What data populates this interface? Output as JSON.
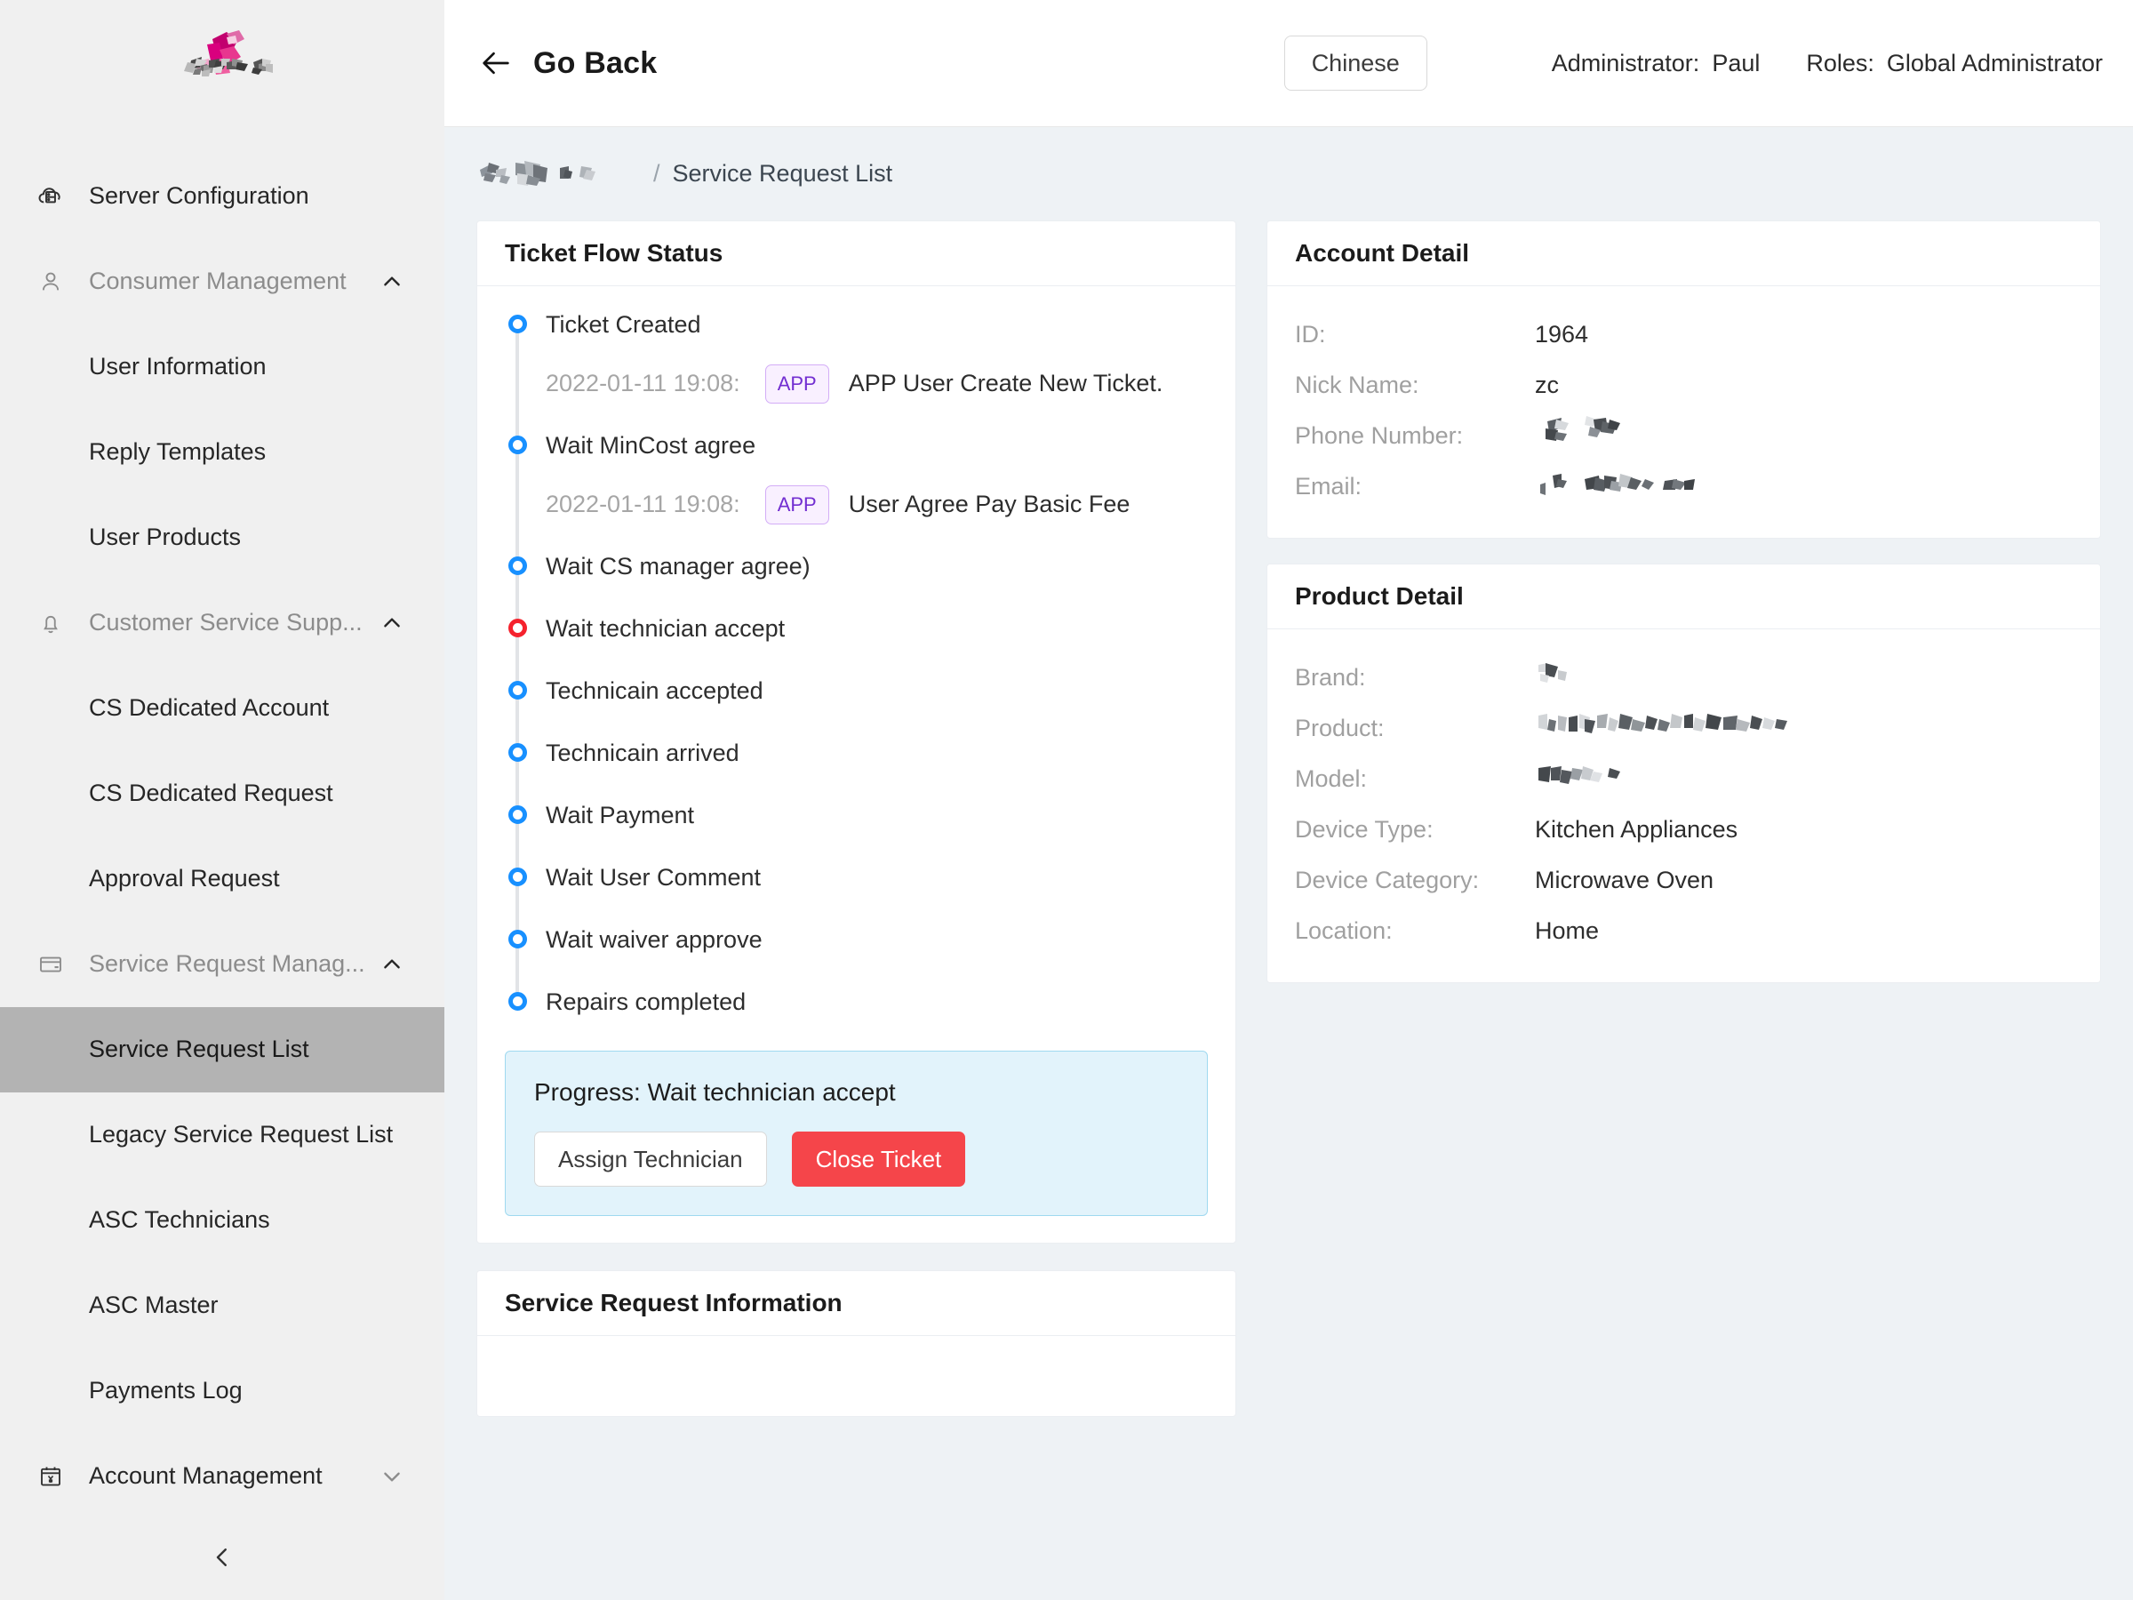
{
  "sidebar": {
    "logo_alt": "company-logo-redacted",
    "items": [
      {
        "type": "group",
        "label": "Server Configuration",
        "icon": "cloud-server-icon",
        "chevron": "",
        "muted": false
      },
      {
        "type": "group",
        "label": "Consumer Management",
        "icon": "user-icon",
        "chevron": "▲",
        "muted": true
      },
      {
        "type": "item",
        "label": "User Information",
        "active": false
      },
      {
        "type": "item",
        "label": "Reply Templates",
        "active": false
      },
      {
        "type": "item",
        "label": "User Products",
        "active": false
      },
      {
        "type": "group",
        "label": "Customer Service Supp...",
        "icon": "bell-icon",
        "chevron": "▲",
        "muted": true
      },
      {
        "type": "item",
        "label": "CS Dedicated Account",
        "active": false
      },
      {
        "type": "item",
        "label": "CS Dedicated Request",
        "active": false
      },
      {
        "type": "item",
        "label": "Approval Request",
        "active": false
      },
      {
        "type": "group",
        "label": "Service Request Manag...",
        "icon": "credit-card-icon",
        "chevron": "▲",
        "muted": true
      },
      {
        "type": "item",
        "label": "Service Request List",
        "active": true
      },
      {
        "type": "item",
        "label": "Legacy Service Request List",
        "active": false
      },
      {
        "type": "item",
        "label": "ASC Technicians",
        "active": false
      },
      {
        "type": "item",
        "label": "ASC Master",
        "active": false
      },
      {
        "type": "item",
        "label": "Payments Log",
        "active": false
      },
      {
        "type": "group",
        "label": "Account Management",
        "icon": "calendar-yen-icon",
        "chevron": "▼",
        "muted": false
      }
    ],
    "collapse_icon": "chevron-left-icon"
  },
  "topbar": {
    "back_icon": "arrow-left-icon",
    "back_label": "Go Back",
    "language_button": "Chinese",
    "administrator_label": "Administrator:",
    "administrator_value": "Paul",
    "roles_label": "Roles:",
    "roles_value": "Global Administrator"
  },
  "breadcrumb": {
    "root": "",
    "separator": "/",
    "current": "Service Request List"
  },
  "ticket_flow": {
    "title": "Ticket Flow Status",
    "steps": [
      {
        "label": "Ticket Created",
        "state": "done",
        "detail": {
          "time": "2022-01-11 19:08:",
          "badge": "APP",
          "message": "APP User Create New Ticket."
        }
      },
      {
        "label": "Wait MinCost agree",
        "state": "done",
        "detail": {
          "time": "2022-01-11 19:08:",
          "badge": "APP",
          "message": "User Agree Pay Basic Fee"
        }
      },
      {
        "label": "Wait CS manager agree)",
        "state": "done",
        "detail": null
      },
      {
        "label": "Wait technician accept",
        "state": "current",
        "detail": null
      },
      {
        "label": "Technicain accepted",
        "state": "pending",
        "detail": null
      },
      {
        "label": "Technicain arrived",
        "state": "pending",
        "detail": null
      },
      {
        "label": "Wait Payment",
        "state": "pending",
        "detail": null
      },
      {
        "label": "Wait User Comment",
        "state": "pending",
        "detail": null
      },
      {
        "label": "Wait waiver approve",
        "state": "pending",
        "detail": null
      },
      {
        "label": "Repairs completed",
        "state": "pending",
        "detail": null
      }
    ],
    "progress": {
      "text": "Progress: Wait technician accept",
      "assign_button": "Assign Technician",
      "close_button": "Close Ticket"
    }
  },
  "account_detail": {
    "title": "Account Detail",
    "rows": [
      {
        "label": "ID:",
        "value": "1964",
        "redacted": false
      },
      {
        "label": "Nick Name:",
        "value": "zc",
        "redacted": false
      },
      {
        "label": "Phone Number:",
        "value": "",
        "redacted": true
      },
      {
        "label": "Email:",
        "value": "",
        "redacted": true
      }
    ]
  },
  "product_detail": {
    "title": "Product Detail",
    "rows": [
      {
        "label": "Brand:",
        "value": "",
        "redacted": true
      },
      {
        "label": "Product:",
        "value": "",
        "redacted": true
      },
      {
        "label": "Model:",
        "value": "",
        "redacted": true
      },
      {
        "label": "Device Type:",
        "value": "Kitchen Appliances",
        "redacted": false
      },
      {
        "label": "Device Category:",
        "value": "Microwave Oven",
        "redacted": false
      },
      {
        "label": "Location:",
        "value": "Home",
        "redacted": false
      }
    ]
  },
  "service_request_information": {
    "title": "Service Request Information"
  },
  "colors": {
    "accent_blue": "#1890ff",
    "current_red": "#f5222d",
    "danger_button": "#f5454a",
    "badge_purple": "#722ed1",
    "alert_bg": "#e2f3fb",
    "sidebar_active": "#b3b3b3"
  }
}
